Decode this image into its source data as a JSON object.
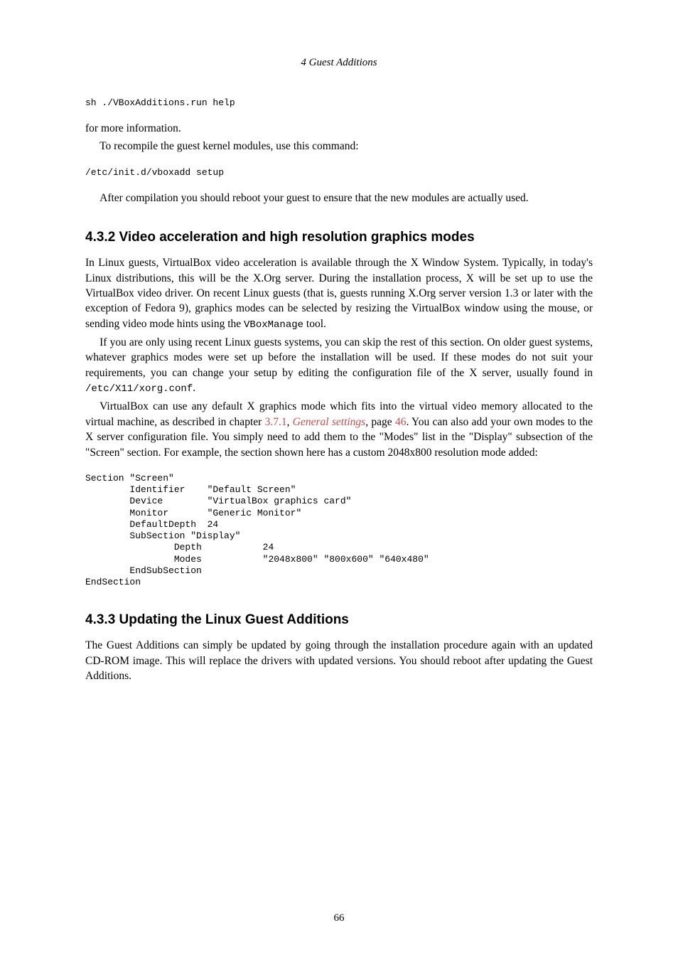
{
  "running_header": "4 Guest Additions",
  "code1": "sh ./VBoxAdditions.run help",
  "para1": "for more information.",
  "para2": "To recompile the guest kernel modules, use this command:",
  "code2": "/etc/init.d/vboxadd setup",
  "para3": "After compilation you should reboot your guest to ensure that the new modules are actually used.",
  "section432": {
    "heading": "4.3.2 Video acceleration and high resolution graphics modes",
    "p1a": "In Linux guests, VirtualBox video acceleration is available through the X Window System. Typically, in today's Linux distributions, this will be the X.Org server. During the installation process, X will be set up to use the VirtualBox video driver. On recent Linux guests (that is, guests running X.Org server version 1.3 or later with the exception of Fedora 9), graphics modes can be selected by resizing the VirtualBox window using the mouse, or sending video mode hints using the ",
    "p1b": "VBoxManage",
    "p1c": " tool.",
    "p2a": "If you are only using recent Linux guests systems, you can skip the rest of this section. On older guest systems, whatever graphics modes were set up before the installation will be used. If these modes do not suit your requirements, you can change your setup by editing the configuration file of the X server, usually found in ",
    "p2b": "/etc/X11/xorg.conf",
    "p2c": ".",
    "p3a": "VirtualBox can use any default X graphics mode which fits into the virtual video memory allocated to the virtual machine, as described in chapter ",
    "p3link1": "3.7.1",
    "p3b": ", ",
    "p3link2": "General settings",
    "p3c": ", page ",
    "p3link3": "46",
    "p3d": ". You can also add your own modes to the X server configuration file. You simply need to add them to the \"Modes\" list in the \"Display\" subsection of the \"Screen\" section. For example, the section shown here has a custom 2048x800 resolution mode added:"
  },
  "code3": "Section \"Screen\"\n        Identifier    \"Default Screen\"\n        Device        \"VirtualBox graphics card\"\n        Monitor       \"Generic Monitor\"\n        DefaultDepth  24\n        SubSection \"Display\"\n                Depth           24\n                Modes           \"2048x800\" \"800x600\" \"640x480\"\n        EndSubSection\nEndSection",
  "section433": {
    "heading": "4.3.3 Updating the Linux Guest Additions",
    "p1": "The Guest Additions can simply be updated by going through the installation procedure again with an updated CD-ROM image. This will replace the drivers with updated versions. You should reboot after updating the Guest Additions."
  },
  "page_number": "66"
}
